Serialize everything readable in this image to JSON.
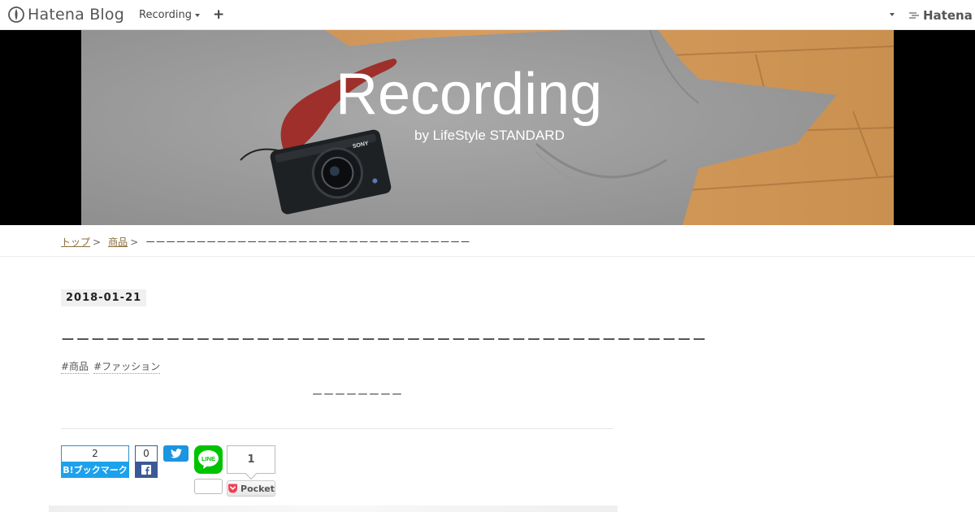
{
  "topbar": {
    "logo_text": "Hatena Blog",
    "blog_menu_label": "Recording",
    "add_label": "+",
    "brand_label": "Hatena"
  },
  "header": {
    "title": "Recording",
    "subtitle": "by LifeStyle STANDARD"
  },
  "breadcrumb": {
    "items": [
      "トップ",
      "商品"
    ],
    "separator": ">",
    "current": "ーーーーーーーーーーーーーーーーーーーーーーーーーーーーーーーー"
  },
  "article": {
    "date": "2018-01-21",
    "title": "ーーーーーーーーーーーーーーーーーーーーーーーーーーーーーーーーーーーーーーーーーーー",
    "tags": [
      "#商品",
      "#ファッション"
    ],
    "subtitle": "ーーーーーーーー"
  },
  "social": {
    "hatena_count": "2",
    "hatena_label": "B!ブックマーク",
    "facebook_count": "0",
    "line_label": "LINE",
    "pocket_count": "1",
    "pocket_label": "Pocket"
  },
  "colors": {
    "hatena_blue": "#1da1ec",
    "facebook": "#3b5998",
    "twitter": "#1b95e0",
    "line": "#00c300",
    "pocket": "#ef4056"
  }
}
